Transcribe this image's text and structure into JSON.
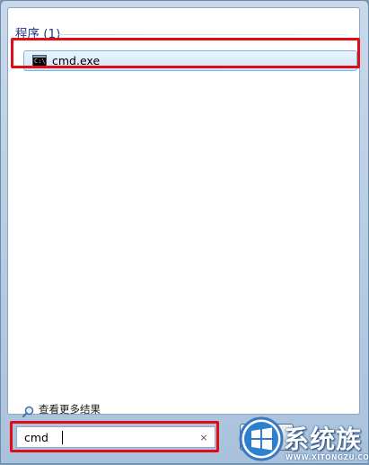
{
  "results": {
    "group_header": "程序 (1)",
    "items": [
      {
        "label": "cmd.exe",
        "icon": "cmd-icon"
      }
    ]
  },
  "see_more": {
    "label": "查看更多结果",
    "icon": "search-icon"
  },
  "search": {
    "value": "cmd",
    "clear_symbol": "×"
  },
  "shutdown": {
    "label": "关"
  },
  "watermark": {
    "title": "系统族",
    "url": "WWW.XITONGZU.COM"
  },
  "colors": {
    "highlight": "#e00c16",
    "group_header": "#1e3a87",
    "selection": "#d1e6fb",
    "frame": "#a9c2dc"
  }
}
